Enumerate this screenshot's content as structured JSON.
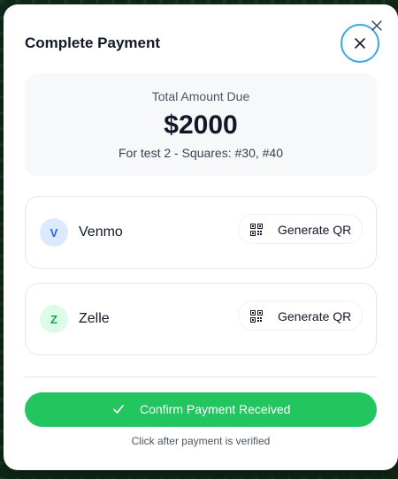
{
  "modal": {
    "title": "Complete Payment"
  },
  "total": {
    "label": "Total Amount Due",
    "amount": "$2000",
    "description": "For test 2 - Squares: #30, #40"
  },
  "methods": [
    {
      "initial": "V",
      "name": "Venmo",
      "button_label": "Generate QR",
      "avatar_bg": "#dbeafe",
      "avatar_fg": "#2563eb"
    },
    {
      "initial": "Z",
      "name": "Zelle",
      "button_label": "Generate QR",
      "avatar_bg": "#dcfce7",
      "avatar_fg": "#16a34a"
    }
  ],
  "confirm": {
    "label": "Confirm Payment Received",
    "hint": "Click after payment is verified"
  },
  "colors": {
    "accent": "#22c55e",
    "focus_ring": "#38a7e6"
  },
  "icons": {
    "close": "close-icon",
    "qr": "qr-code-icon",
    "check": "check-icon"
  }
}
